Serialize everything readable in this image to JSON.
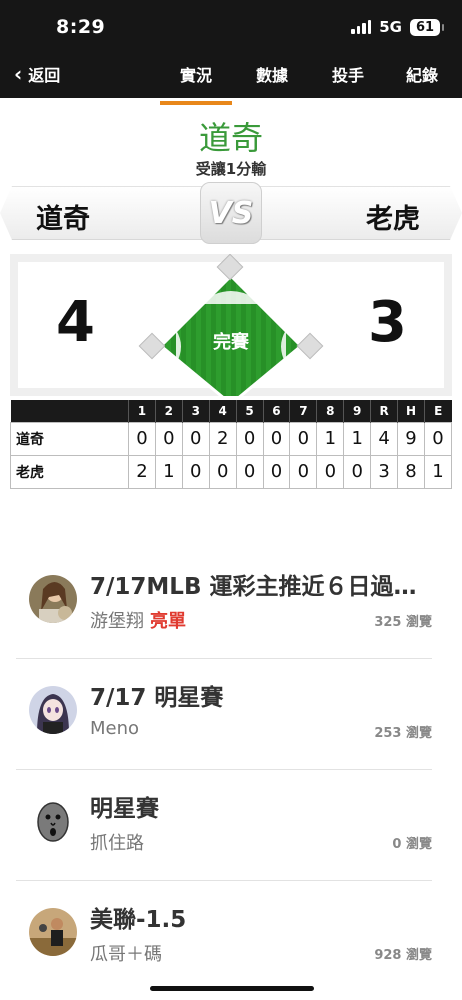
{
  "status_bar": {
    "time": "8:29",
    "network": "5G",
    "battery": "61"
  },
  "nav": {
    "back_label": "返回",
    "tabs": [
      {
        "label": "實況",
        "active": true
      },
      {
        "label": "數據",
        "active": false
      },
      {
        "label": "投手",
        "active": false
      },
      {
        "label": "紀錄",
        "active": false
      }
    ]
  },
  "game": {
    "title": "道奇",
    "subtitle": "受讓1分輸",
    "away_team": "道奇",
    "home_team": "老虎",
    "vs": "VS",
    "away_score": "4",
    "home_score": "3",
    "status": "完賽",
    "field_color": "#2e9d2e"
  },
  "boxscore": {
    "headers": [
      "",
      "1",
      "2",
      "3",
      "4",
      "5",
      "6",
      "7",
      "8",
      "9",
      "R",
      "H",
      "E"
    ],
    "rows": [
      {
        "team": "道奇",
        "cells": [
          "0",
          "0",
          "0",
          "2",
          "0",
          "0",
          "0",
          "1",
          "1",
          "4",
          "9",
          "0"
        ]
      },
      {
        "team": "老虎",
        "cells": [
          "2",
          "1",
          "0",
          "0",
          "0",
          "0",
          "0",
          "0",
          "0",
          "3",
          "8",
          "1"
        ]
      }
    ]
  },
  "posts": [
    {
      "title": "7/17MLB 運彩主推近６日過…",
      "author": "游堡翔",
      "badge": "亮單",
      "views": "325 瀏覽",
      "avatar_icon": "avatar-photo-woman"
    },
    {
      "title": "7/17 明星賽",
      "author": "Meno",
      "badge": "",
      "views": "253 瀏覽",
      "avatar_icon": "avatar-anime-girl"
    },
    {
      "title": "明星賽",
      "author": "抓住路",
      "badge": "",
      "views": "0 瀏覽",
      "avatar_icon": "avatar-cartoon-face"
    },
    {
      "title": "美聯-1.5",
      "author": "瓜哥＋碼",
      "badge": "",
      "views": "928 瀏覽",
      "avatar_icon": "avatar-photo-man"
    }
  ],
  "colors": {
    "accent": "#e8871a",
    "title_green": "#3a9a3a",
    "badge_red": "#e03a2f"
  }
}
